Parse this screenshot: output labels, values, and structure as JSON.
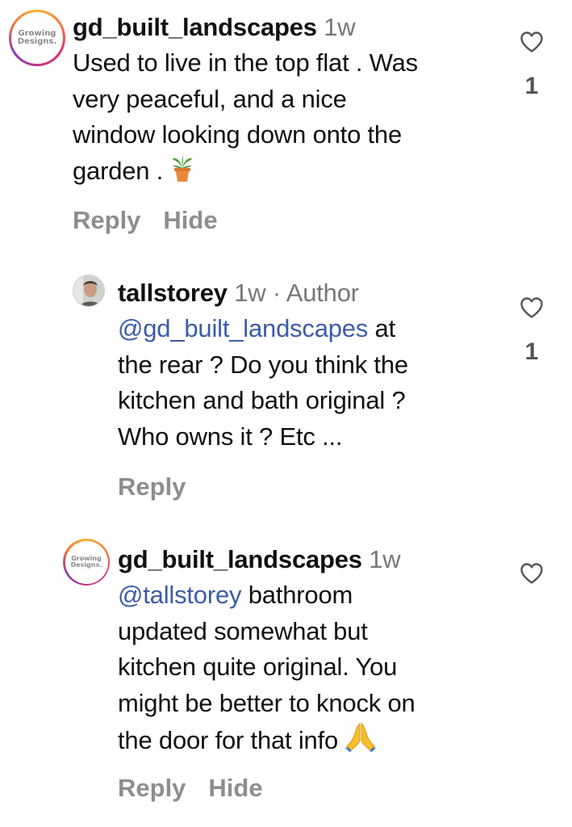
{
  "comments": [
    {
      "username": "gd_built_landscapes",
      "time": "1w",
      "avatar_text": [
        "Growing",
        "Designs."
      ],
      "text": [
        "Used to live in the top flat . Was",
        "very peaceful, and a nice",
        "window looking down onto the",
        "garden . "
      ],
      "emoji_icon": "potted-plant-icon",
      "like_count": "1",
      "actions": {
        "reply": "Reply",
        "hide": "Hide"
      }
    },
    {
      "username": "tallstorey",
      "time": "1w",
      "author_suffix": " · Author",
      "mention": "@gd_built_landscapes",
      "text": [
        " at",
        "the rear ? Do you think the",
        "kitchen and bath original ?",
        "Who owns it ? Etc ..."
      ],
      "like_count": "1",
      "actions": {
        "reply": "Reply"
      }
    },
    {
      "username": "gd_built_landscapes",
      "time": "1w",
      "avatar_text": [
        "Growing",
        "Designs."
      ],
      "mention": "@tallstorey",
      "text": [
        " bathroom",
        "updated somewhat but",
        "kitchen quite original. You",
        "might be better to knock on",
        "the door for that info "
      ],
      "emoji_icon": "folded-hands-icon",
      "like_count": "",
      "actions": {
        "reply": "Reply",
        "hide": "Hide"
      }
    }
  ],
  "colors": {
    "mention": "#3b5ca8",
    "muted": "#8e8e8e",
    "ring_start": "#f9b233",
    "ring_end": "#c13584"
  }
}
